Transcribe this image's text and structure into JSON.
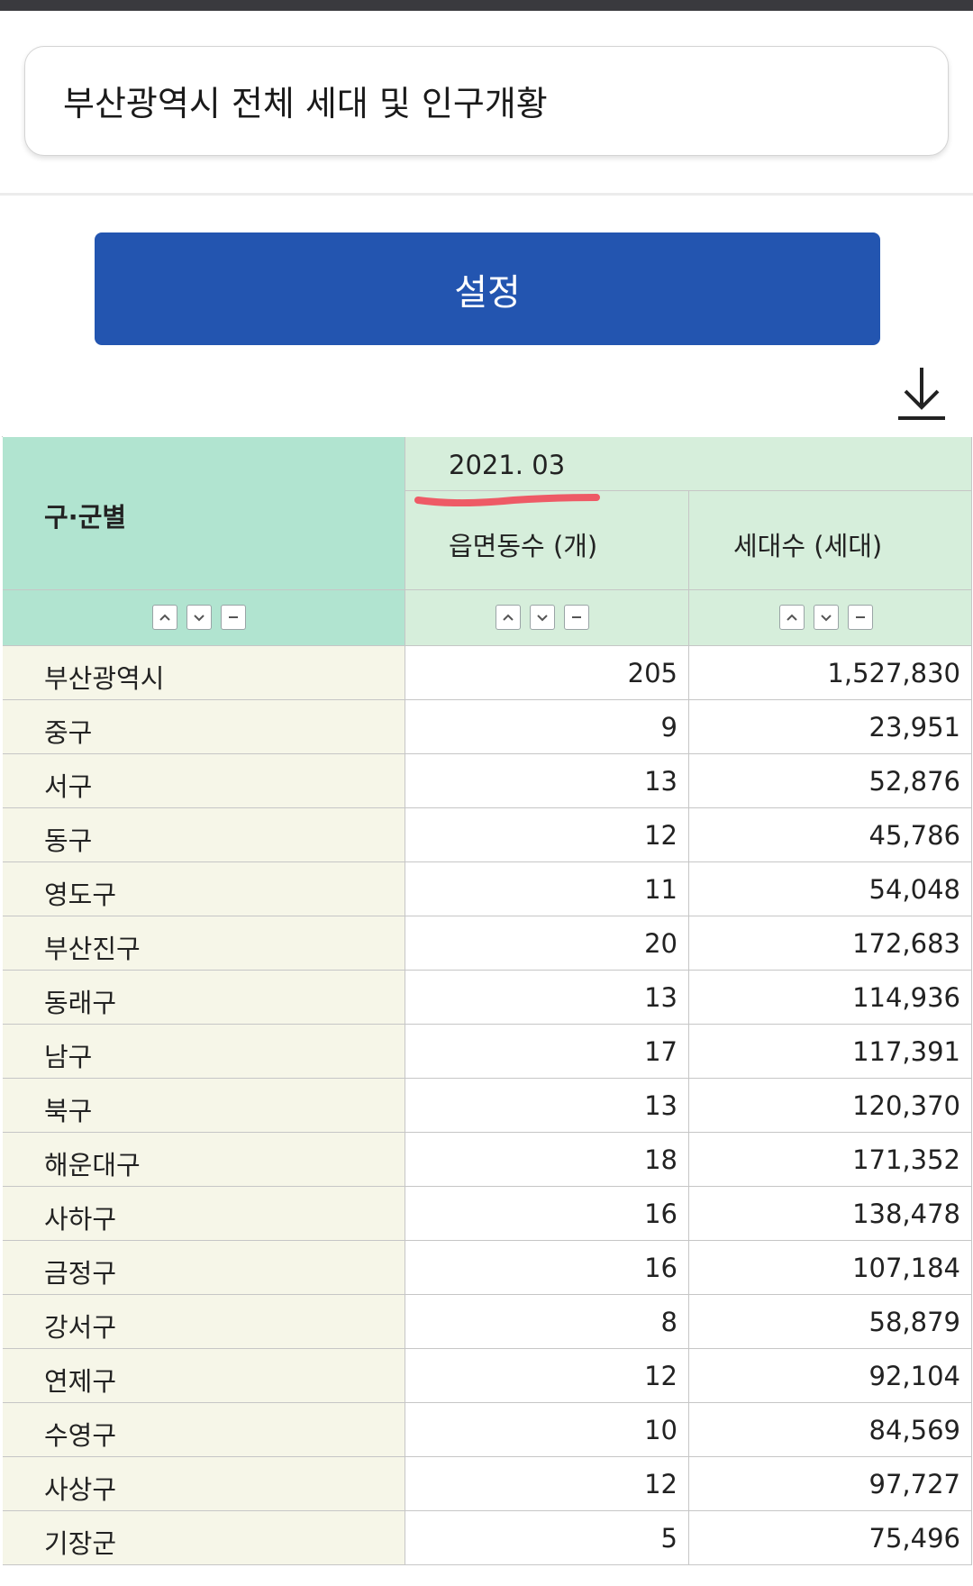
{
  "title": "부산광역시 전체 세대 및 인구개황",
  "settings_button": "설정",
  "icons": {
    "download": "download-icon",
    "sort_up": "chevron-up-icon",
    "sort_down": "chevron-down-icon",
    "remove": "minus-icon"
  },
  "colors": {
    "button": "#2355b0",
    "header_left": "#b1e4d0",
    "header_right": "#d6eedb",
    "row_label": "#f6f6e8",
    "annotation": "#ee5a66"
  },
  "table": {
    "header": {
      "group_label": "구·군별",
      "period": "2021. 03",
      "col1": "읍면동수 (개)",
      "col2": "세대수 (세대)"
    },
    "rows": [
      {
        "name": "부산광역시",
        "dong": "205",
        "households": "1,527,830"
      },
      {
        "name": "중구",
        "dong": "9",
        "households": "23,951"
      },
      {
        "name": "서구",
        "dong": "13",
        "households": "52,876"
      },
      {
        "name": "동구",
        "dong": "12",
        "households": "45,786"
      },
      {
        "name": "영도구",
        "dong": "11",
        "households": "54,048"
      },
      {
        "name": "부산진구",
        "dong": "20",
        "households": "172,683"
      },
      {
        "name": "동래구",
        "dong": "13",
        "households": "114,936"
      },
      {
        "name": "남구",
        "dong": "17",
        "households": "117,391"
      },
      {
        "name": "북구",
        "dong": "13",
        "households": "120,370"
      },
      {
        "name": "해운대구",
        "dong": "18",
        "households": "171,352"
      },
      {
        "name": "사하구",
        "dong": "16",
        "households": "138,478"
      },
      {
        "name": "금정구",
        "dong": "16",
        "households": "107,184"
      },
      {
        "name": "강서구",
        "dong": "8",
        "households": "58,879"
      },
      {
        "name": "연제구",
        "dong": "12",
        "households": "92,104"
      },
      {
        "name": "수영구",
        "dong": "10",
        "households": "84,569"
      },
      {
        "name": "사상구",
        "dong": "12",
        "households": "97,727"
      },
      {
        "name": "기장군",
        "dong": "5",
        "households": "75,496"
      }
    ]
  }
}
